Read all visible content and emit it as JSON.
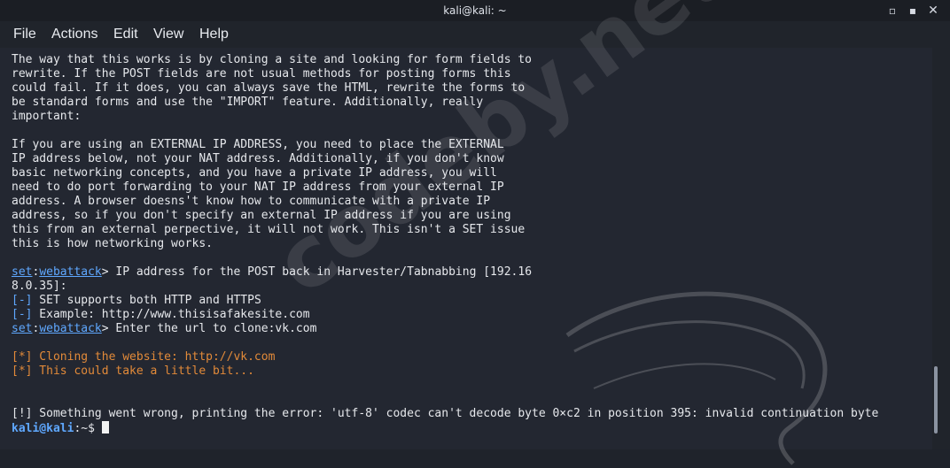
{
  "window": {
    "title": "kali@kali: ~",
    "controls": [
      "minimize-icon",
      "maximize-icon",
      "close-icon"
    ]
  },
  "menu": {
    "file": "File",
    "actions": "Actions",
    "edit": "Edit",
    "view": "View",
    "help": "Help"
  },
  "terminal": {
    "p1_l1": "The way that this works is by cloning a site and looking for form fields to",
    "p1_l2": "rewrite. If the POST fields are not usual methods for posting forms this",
    "p1_l3": "could fail. If it does, you can always save the HTML, rewrite the forms to",
    "p1_l4": "be standard forms and use the \"IMPORT\" feature. Additionally, really",
    "p1_l5": "important:",
    "p2_l1": "If you are using an EXTERNAL IP ADDRESS, you need to place the EXTERNAL",
    "p2_l2": "IP address below, not your NAT address. Additionally, if you don't know",
    "p2_l3": "basic networking concepts, and you have a private IP address, you will",
    "p2_l4": "need to do port forwarding to your NAT IP address from your external IP",
    "p2_l5": "address. A browser doesns't know how to communicate with a private IP",
    "p2_l6": "address, so if you don't specify an external IP address if you are using",
    "p2_l7": "this from an external perpective, it will not work. This isn't a SET issue",
    "p2_l8": "this is how networking works.",
    "prompt_set": "set",
    "prompt_colon": ":",
    "prompt_web": "webattack",
    "q1": "> IP address for the POST back in Harvester/Tabnabbing [192.16",
    "q1_cont": "8.0.35]:",
    "info_tag": "[-]",
    "info1": " SET supports both HTTP and HTTPS",
    "info2": " Example: http://www.thisisafakesite.com",
    "q2": "> Enter the url to clone:vk.com",
    "cloning": "[*] Cloning the website: http://vk.com",
    "wait": "[*] This could take a little bit...",
    "error": "[!] Something went wrong, printing the error: 'utf-8' codec can't decode byte 0×c2 in position 395: invalid continuation byte",
    "user": "kali@kali",
    "path": ":~$ "
  },
  "watermark": {
    "text": "codeby.net"
  }
}
